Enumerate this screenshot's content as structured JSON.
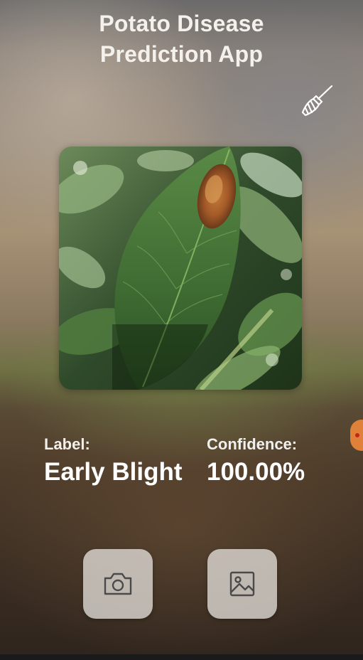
{
  "app": {
    "title_line1": "Potato Disease",
    "title_line2": "Prediction App"
  },
  "toolbar": {
    "clear_icon": "broom-icon"
  },
  "image_preview": {
    "description_icon": "leaf-photo"
  },
  "result": {
    "label_heading": "Label:",
    "label_value": "Early Blight",
    "confidence_heading": "Confidence:",
    "confidence_value": "100.00%"
  },
  "actions": {
    "camera_icon": "camera-icon",
    "gallery_icon": "image-gallery-icon"
  },
  "colors": {
    "text": "#ffffff",
    "button_bg": "#eeece8",
    "icon": "#555555"
  }
}
